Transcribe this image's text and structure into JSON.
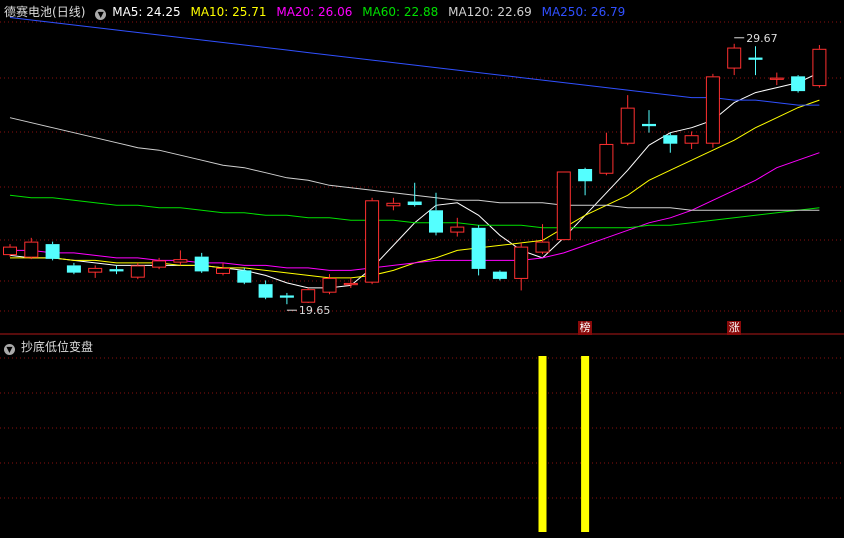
{
  "header": {
    "stock_name": "德赛电池",
    "period": "(日线)",
    "ma5": "MA5: 24.25",
    "ma10": "MA10: 25.71",
    "ma20": "MA20: 26.06",
    "ma60": "MA60: 22.88",
    "ma120": "MA120: 22.69",
    "ma250": "MA250: 26.79"
  },
  "indicator": {
    "title": "抄底低位变盘"
  },
  "colors": {
    "up": "#ff3030",
    "down": "#54ffff",
    "ma5": "#ffffff",
    "ma10": "#ffff00",
    "ma20": "#ff00ff",
    "ma60": "#00e000",
    "ma120": "#d0d0d0",
    "ma250": "#3050ff",
    "signal": "#ffff00",
    "grid": "#8a1010"
  },
  "chart_data": {
    "type": "candlestick",
    "price_range": [
      18.5,
      31.0
    ],
    "annotations": {
      "low_label": "19.65",
      "high_label": "29.67"
    },
    "badges": [
      "榜",
      "涨"
    ],
    "candles": [
      {
        "o": 21.65,
        "c": 21.95,
        "h": 22.05,
        "l": 21.55
      },
      {
        "o": 21.55,
        "c": 22.15,
        "h": 22.3,
        "l": 21.45
      },
      {
        "o": 22.05,
        "c": 21.5,
        "h": 22.15,
        "l": 21.4
      },
      {
        "o": 21.2,
        "c": 20.95,
        "h": 21.3,
        "l": 20.85
      },
      {
        "o": 20.95,
        "c": 21.1,
        "h": 21.2,
        "l": 20.7
      },
      {
        "o": 21.05,
        "c": 21.0,
        "h": 21.2,
        "l": 20.85
      },
      {
        "o": 20.75,
        "c": 21.2,
        "h": 21.3,
        "l": 20.65
      },
      {
        "o": 21.15,
        "c": 21.4,
        "h": 21.5,
        "l": 21.05
      },
      {
        "o": 21.35,
        "c": 21.45,
        "h": 21.8,
        "l": 21.2
      },
      {
        "o": 21.55,
        "c": 21.0,
        "h": 21.7,
        "l": 20.9
      },
      {
        "o": 20.9,
        "c": 21.1,
        "h": 21.3,
        "l": 20.8
      },
      {
        "o": 21.0,
        "c": 20.55,
        "h": 21.1,
        "l": 20.45
      },
      {
        "o": 20.45,
        "c": 19.95,
        "h": 20.6,
        "l": 19.85
      },
      {
        "o": 20.0,
        "c": 19.95,
        "h": 20.1,
        "l": 19.65
      },
      {
        "o": 19.75,
        "c": 20.25,
        "h": 20.3,
        "l": 19.7
      },
      {
        "o": 20.15,
        "c": 20.7,
        "h": 20.85,
        "l": 20.05
      },
      {
        "o": 20.45,
        "c": 20.5,
        "h": 20.7,
        "l": 20.3
      },
      {
        "o": 20.55,
        "c": 23.8,
        "h": 23.9,
        "l": 20.45
      },
      {
        "o": 23.6,
        "c": 23.7,
        "h": 23.9,
        "l": 23.4
      },
      {
        "o": 23.75,
        "c": 23.65,
        "h": 24.5,
        "l": 23.55
      },
      {
        "o": 23.4,
        "c": 22.55,
        "h": 24.1,
        "l": 22.4
      },
      {
        "o": 22.55,
        "c": 22.75,
        "h": 23.1,
        "l": 22.35
      },
      {
        "o": 22.7,
        "c": 21.1,
        "h": 22.8,
        "l": 20.8
      },
      {
        "o": 20.95,
        "c": 20.7,
        "h": 21.0,
        "l": 20.6
      },
      {
        "o": 20.7,
        "c": 21.95,
        "h": 22.1,
        "l": 20.2
      },
      {
        "o": 21.75,
        "c": 22.15,
        "h": 22.85,
        "l": 21.65
      },
      {
        "o": 22.25,
        "c": 24.95,
        "h": 24.95,
        "l": 22.2
      },
      {
        "o": 25.05,
        "c": 24.6,
        "h": 25.1,
        "l": 24.0
      },
      {
        "o": 24.9,
        "c": 26.05,
        "h": 26.5,
        "l": 24.8
      },
      {
        "o": 26.1,
        "c": 27.5,
        "h": 28.0,
        "l": 26.0
      },
      {
        "o": 26.85,
        "c": 26.8,
        "h": 27.4,
        "l": 26.5
      },
      {
        "o": 26.4,
        "c": 26.1,
        "h": 26.5,
        "l": 25.7
      },
      {
        "o": 26.1,
        "c": 26.4,
        "h": 26.55,
        "l": 25.85
      },
      {
        "o": 26.1,
        "c": 28.75,
        "h": 28.85,
        "l": 25.9
      },
      {
        "o": 29.1,
        "c": 29.9,
        "h": 30.05,
        "l": 28.8
      },
      {
        "o": 29.5,
        "c": 29.45,
        "h": 29.95,
        "l": 28.8
      },
      {
        "o": 28.65,
        "c": 28.7,
        "h": 28.9,
        "l": 28.4
      },
      {
        "o": 28.75,
        "c": 28.2,
        "h": 28.8,
        "l": 28.1
      },
      {
        "o": 28.4,
        "c": 29.85,
        "h": 30.0,
        "l": 28.3
      }
    ],
    "ma": {
      "MA5": [
        21.6,
        21.5,
        21.5,
        21.4,
        21.3,
        21.2,
        21.2,
        21.2,
        21.2,
        21.2,
        21.1,
        21.0,
        20.8,
        20.5,
        20.3,
        20.3,
        20.4,
        21.1,
        22.0,
        22.9,
        23.6,
        23.7,
        23.2,
        22.4,
        21.8,
        21.5,
        22.3,
        23.2,
        24.1,
        25.0,
        26.0,
        26.5,
        26.7,
        27.0,
        27.7,
        28.1,
        28.3,
        28.5,
        28.9
      ],
      "MA10": [
        21.5,
        21.5,
        21.5,
        21.4,
        21.4,
        21.3,
        21.3,
        21.3,
        21.2,
        21.2,
        21.1,
        21.1,
        21.0,
        20.9,
        20.8,
        20.7,
        20.7,
        20.8,
        21.0,
        21.3,
        21.5,
        21.8,
        21.9,
        22.0,
        22.1,
        22.2,
        22.7,
        23.2,
        23.6,
        24.0,
        24.6,
        25.0,
        25.4,
        25.8,
        26.2,
        26.7,
        27.1,
        27.5,
        27.8
      ],
      "MA20": [
        21.8,
        21.8,
        21.7,
        21.7,
        21.6,
        21.5,
        21.5,
        21.4,
        21.4,
        21.3,
        21.3,
        21.2,
        21.2,
        21.1,
        21.1,
        21.0,
        21.0,
        21.1,
        21.2,
        21.3,
        21.4,
        21.4,
        21.4,
        21.4,
        21.4,
        21.5,
        21.7,
        22.0,
        22.3,
        22.6,
        22.9,
        23.1,
        23.4,
        23.8,
        24.2,
        24.6,
        25.1,
        25.4,
        25.7
      ],
      "MA60": [
        24.0,
        23.9,
        23.9,
        23.8,
        23.7,
        23.6,
        23.6,
        23.5,
        23.5,
        23.4,
        23.3,
        23.3,
        23.2,
        23.2,
        23.1,
        23.1,
        23.0,
        23.0,
        23.0,
        22.9,
        22.9,
        22.9,
        22.8,
        22.8,
        22.8,
        22.7,
        22.7,
        22.7,
        22.7,
        22.7,
        22.8,
        22.8,
        22.9,
        23.0,
        23.1,
        23.2,
        23.3,
        23.4,
        23.5
      ],
      "MA120": [
        27.1,
        26.9,
        26.7,
        26.5,
        26.3,
        26.1,
        25.9,
        25.8,
        25.6,
        25.4,
        25.2,
        25.1,
        24.9,
        24.7,
        24.6,
        24.4,
        24.3,
        24.2,
        24.1,
        24.0,
        23.9,
        23.8,
        23.8,
        23.7,
        23.7,
        23.7,
        23.6,
        23.6,
        23.6,
        23.5,
        23.5,
        23.5,
        23.4,
        23.4,
        23.4,
        23.4,
        23.4,
        23.4,
        23.4
      ],
      "MA250": [
        31.1,
        31.0,
        30.9,
        30.8,
        30.7,
        30.6,
        30.5,
        30.4,
        30.3,
        30.2,
        30.1,
        30.0,
        29.9,
        29.8,
        29.7,
        29.6,
        29.5,
        29.4,
        29.3,
        29.2,
        29.1,
        29.0,
        28.9,
        28.8,
        28.7,
        28.6,
        28.5,
        28.4,
        28.3,
        28.2,
        28.1,
        28.0,
        27.9,
        27.9,
        27.8,
        27.8,
        27.7,
        27.6,
        27.6
      ]
    },
    "signal_bars": [
      25,
      27
    ]
  }
}
